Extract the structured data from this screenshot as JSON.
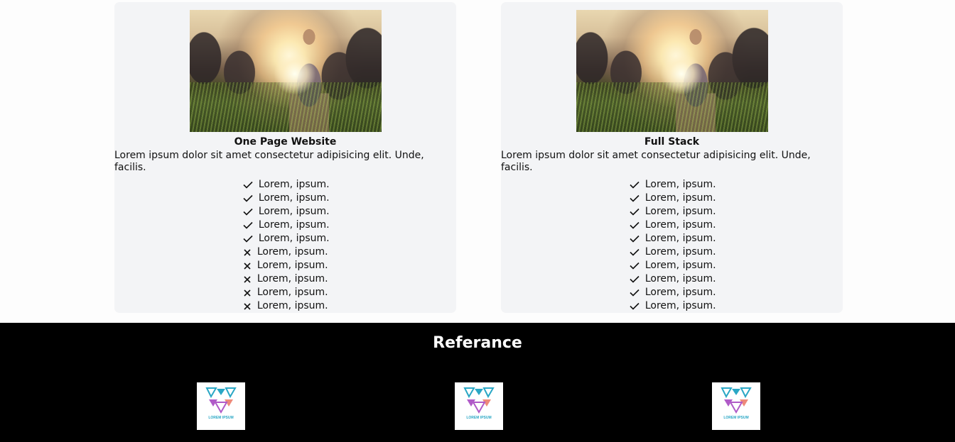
{
  "cards": [
    {
      "title": "One Page Website",
      "description": "Lorem ipsum dolor sit amet consectetur adipisicing elit. Unde, facilis.",
      "features": [
        {
          "label": "Lorem, ipsum.",
          "included": true
        },
        {
          "label": "Lorem, ipsum.",
          "included": true
        },
        {
          "label": "Lorem, ipsum.",
          "included": true
        },
        {
          "label": "Lorem, ipsum.",
          "included": true
        },
        {
          "label": "Lorem, ipsum.",
          "included": true
        },
        {
          "label": "Lorem, ipsum.",
          "included": false
        },
        {
          "label": "Lorem, ipsum.",
          "included": false
        },
        {
          "label": "Lorem, ipsum.",
          "included": false
        },
        {
          "label": "Lorem, ipsum.",
          "included": false
        },
        {
          "label": "Lorem, ipsum.",
          "included": false
        }
      ]
    },
    {
      "title": "Full Stack",
      "description": "Lorem ipsum dolor sit amet consectetur adipisicing elit. Unde, facilis.",
      "features": [
        {
          "label": "Lorem, ipsum.",
          "included": true
        },
        {
          "label": "Lorem, ipsum.",
          "included": true
        },
        {
          "label": "Lorem, ipsum.",
          "included": true
        },
        {
          "label": "Lorem, ipsum.",
          "included": true
        },
        {
          "label": "Lorem, ipsum.",
          "included": true
        },
        {
          "label": "Lorem, ipsum.",
          "included": true
        },
        {
          "label": "Lorem, ipsum.",
          "included": true
        },
        {
          "label": "Lorem, ipsum.",
          "included": true
        },
        {
          "label": "Lorem, ipsum.",
          "included": true
        },
        {
          "label": "Lorem, ipsum.",
          "included": true
        }
      ]
    }
  ],
  "references": {
    "title": "Referance",
    "logos": [
      {
        "icon": "lorem-ipsum-logo",
        "text": "LOREM IPSUM"
      },
      {
        "icon": "lorem-ipsum-logo",
        "text": "LOREM IPSUM"
      },
      {
        "icon": "lorem-ipsum-logo",
        "text": "LOREM IPSUM"
      }
    ]
  },
  "colors": {
    "card_bg": "#f3f4f6",
    "footer_bg": "#000000",
    "logo_teal": "#2aa7c5",
    "logo_purple": "#b05bc8",
    "logo_coral": "#ee8a7a"
  }
}
